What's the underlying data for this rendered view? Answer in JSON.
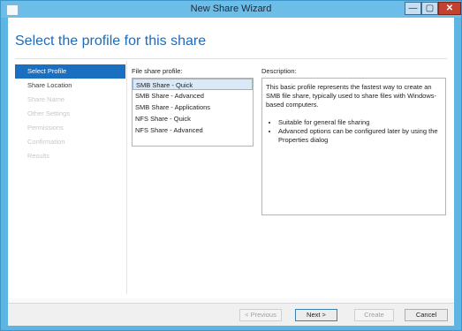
{
  "window": {
    "title": "New Share Wizard",
    "min_glyph": "—",
    "max_glyph": "▢",
    "close_glyph": "✕"
  },
  "header": {
    "title": "Select the profile for this share"
  },
  "nav": {
    "items": [
      {
        "label": "Select Profile",
        "state": "selected"
      },
      {
        "label": "Share Location",
        "state": "enabled"
      },
      {
        "label": "Share Name",
        "state": "disabled"
      },
      {
        "label": "Other Settings",
        "state": "disabled"
      },
      {
        "label": "Permissions",
        "state": "disabled"
      },
      {
        "label": "Confirmation",
        "state": "disabled"
      },
      {
        "label": "Results",
        "state": "disabled"
      }
    ]
  },
  "profiles": {
    "label": "File share profile:",
    "items": [
      {
        "label": "SMB Share - Quick",
        "selected": true
      },
      {
        "label": "SMB Share - Advanced",
        "selected": false
      },
      {
        "label": "SMB Share - Applications",
        "selected": false
      },
      {
        "label": "NFS Share - Quick",
        "selected": false
      },
      {
        "label": "NFS Share - Advanced",
        "selected": false
      }
    ]
  },
  "description": {
    "label": "Description:",
    "text": "This basic profile represents the fastest way to create an SMB file share, typically used to share files with Windows-based computers.",
    "bullets": [
      "Suitable for general file sharing",
      "Advanced options can be configured later by using the Properties dialog"
    ]
  },
  "footer": {
    "previous": "< Previous",
    "next": "Next >",
    "create": "Create",
    "cancel": "Cancel"
  },
  "colors": {
    "frame": "#5fb5e2",
    "accent": "#1a6fc0",
    "title_blue": "#1e6bbb"
  }
}
